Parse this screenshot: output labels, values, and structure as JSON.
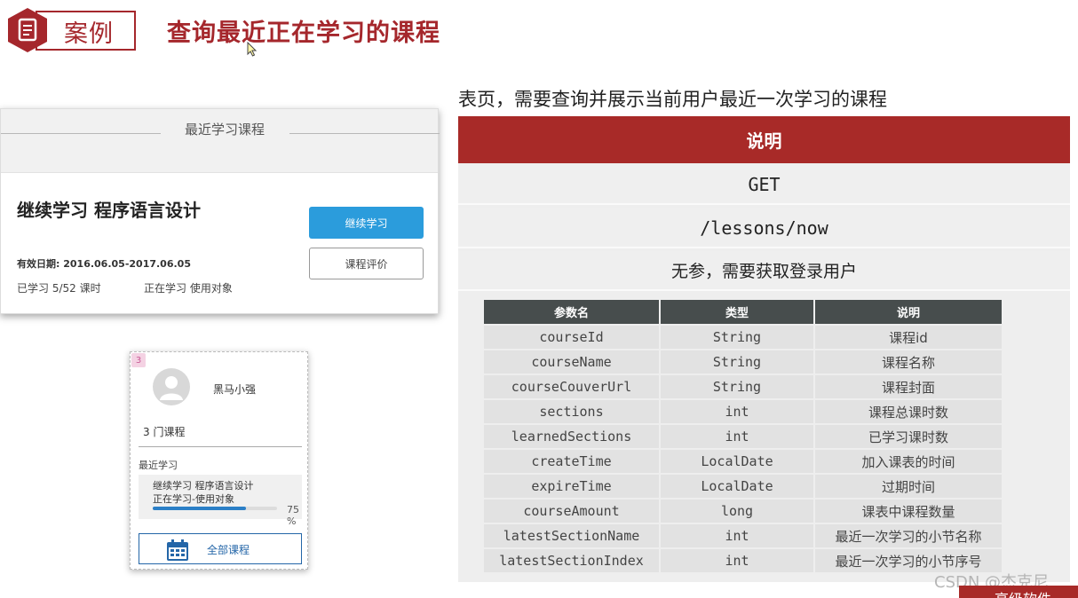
{
  "header": {
    "badge_icon": "document-icon",
    "case_label": "案例",
    "title": "查询最近正在学习的课程"
  },
  "course_card": {
    "section_title": "最近学习课程",
    "course_name": "继续学习  程序语言设计",
    "valid_date": "有效日期: 2016.06.05-2017.06.05",
    "learned": "已学习    5/52 课时",
    "status": "正在学习  使用对象",
    "continue_button": "继续学习",
    "rate_button": "课程评价"
  },
  "user_card": {
    "badge_number": "3",
    "avatar_icon": "user-avatar-icon",
    "user_name": "黑马小强",
    "course_count": "3  门课程",
    "recent_label": "最近学习",
    "recent_course": "继续学习 程序语言设计",
    "recent_status": "正在学习-使用对象",
    "progress_text": "75%",
    "progress_fraction": 0.75,
    "all_courses_icon": "calendar-icon",
    "all_courses_label": "全部课程"
  },
  "api": {
    "description": "表页，需要查询并展示当前用户最近一次学习的课程",
    "header": "说明",
    "method": "GET",
    "path": "/lessons/now",
    "params_note": "无参，需要获取登录用户",
    "table": {
      "columns": [
        "参数名",
        "类型",
        "说明"
      ],
      "rows": [
        [
          "courseId",
          "String",
          "课程id"
        ],
        [
          "courseName",
          "String",
          "课程名称"
        ],
        [
          "courseCouverUrl",
          "String",
          "课程封面"
        ],
        [
          "sections",
          "int",
          "课程总课时数"
        ],
        [
          "learnedSections",
          "int",
          "已学习课时数"
        ],
        [
          "createTime",
          "LocalDate",
          "加入课表的时间"
        ],
        [
          "expireTime",
          "LocalDate",
          "过期时间"
        ],
        [
          "courseAmount",
          "long",
          "课表中课程数量"
        ],
        [
          "latestSectionName",
          "int",
          "最近一次学习的小节名称"
        ],
        [
          "latestSectionIndex",
          "int",
          "最近一次学习的小节序号"
        ]
      ]
    }
  },
  "watermark": "CSDN @杰克尼",
  "footer_strip": "高级软件",
  "colors": {
    "accent_red": "#a82a28",
    "button_blue": "#2b9cdc",
    "table_header": "#474d4d",
    "progress_blue": "#2b7fc7"
  }
}
